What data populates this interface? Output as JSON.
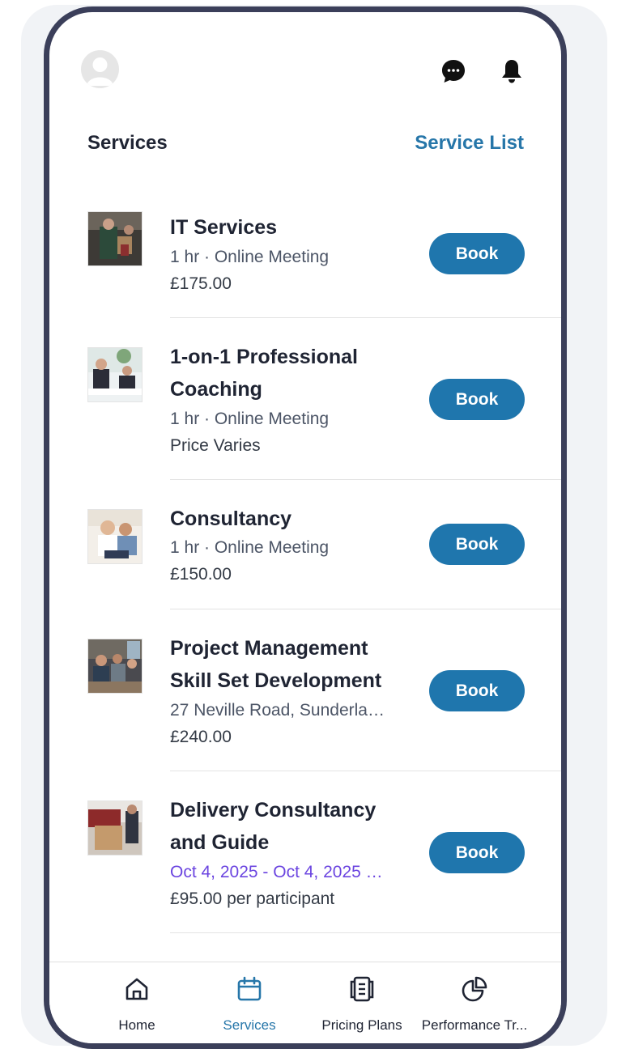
{
  "header": {
    "section_title": "Services",
    "service_list_link": "Service List",
    "icons": [
      "avatar",
      "chat-icon",
      "bell-icon"
    ]
  },
  "services": [
    {
      "title_lines": [
        "IT Services"
      ],
      "detail": "1 hr · Online Meeting",
      "price": "£175.00",
      "book_label": "Book"
    },
    {
      "title_lines": [
        "1-on-1 Professional",
        "Coaching"
      ],
      "detail": "1 hr · Online Meeting",
      "price": "Price Varies",
      "book_label": "Book"
    },
    {
      "title_lines": [
        "Consultancy"
      ],
      "detail": "1 hr · Online Meeting",
      "price": "£150.00",
      "book_label": "Book"
    },
    {
      "title_lines": [
        "Project Management",
        "Skill Set Development"
      ],
      "detail": "27 Neville Road, Sunderla…",
      "price": "£240.00",
      "book_label": "Book"
    },
    {
      "title_lines": [
        "Delivery Consultancy",
        "and Guide"
      ],
      "detail": "Oct 4, 2025 - Oct 4, 2025 …",
      "price": "£95.00 per participant",
      "book_label": "Book"
    }
  ],
  "colors": {
    "accent": "#2676a9",
    "book_button": "#1f76ad",
    "date_text": "#6b45e0",
    "phone_frame": "#3b3f5a"
  },
  "bottom_nav": [
    {
      "label": "Home",
      "icon": "home-icon",
      "active": false
    },
    {
      "label": "Services",
      "icon": "calendar-icon",
      "active": true
    },
    {
      "label": "Pricing Plans",
      "icon": "document-icon",
      "active": false
    },
    {
      "label": "Performance Tr...",
      "icon": "pie-chart-icon",
      "active": false
    }
  ]
}
